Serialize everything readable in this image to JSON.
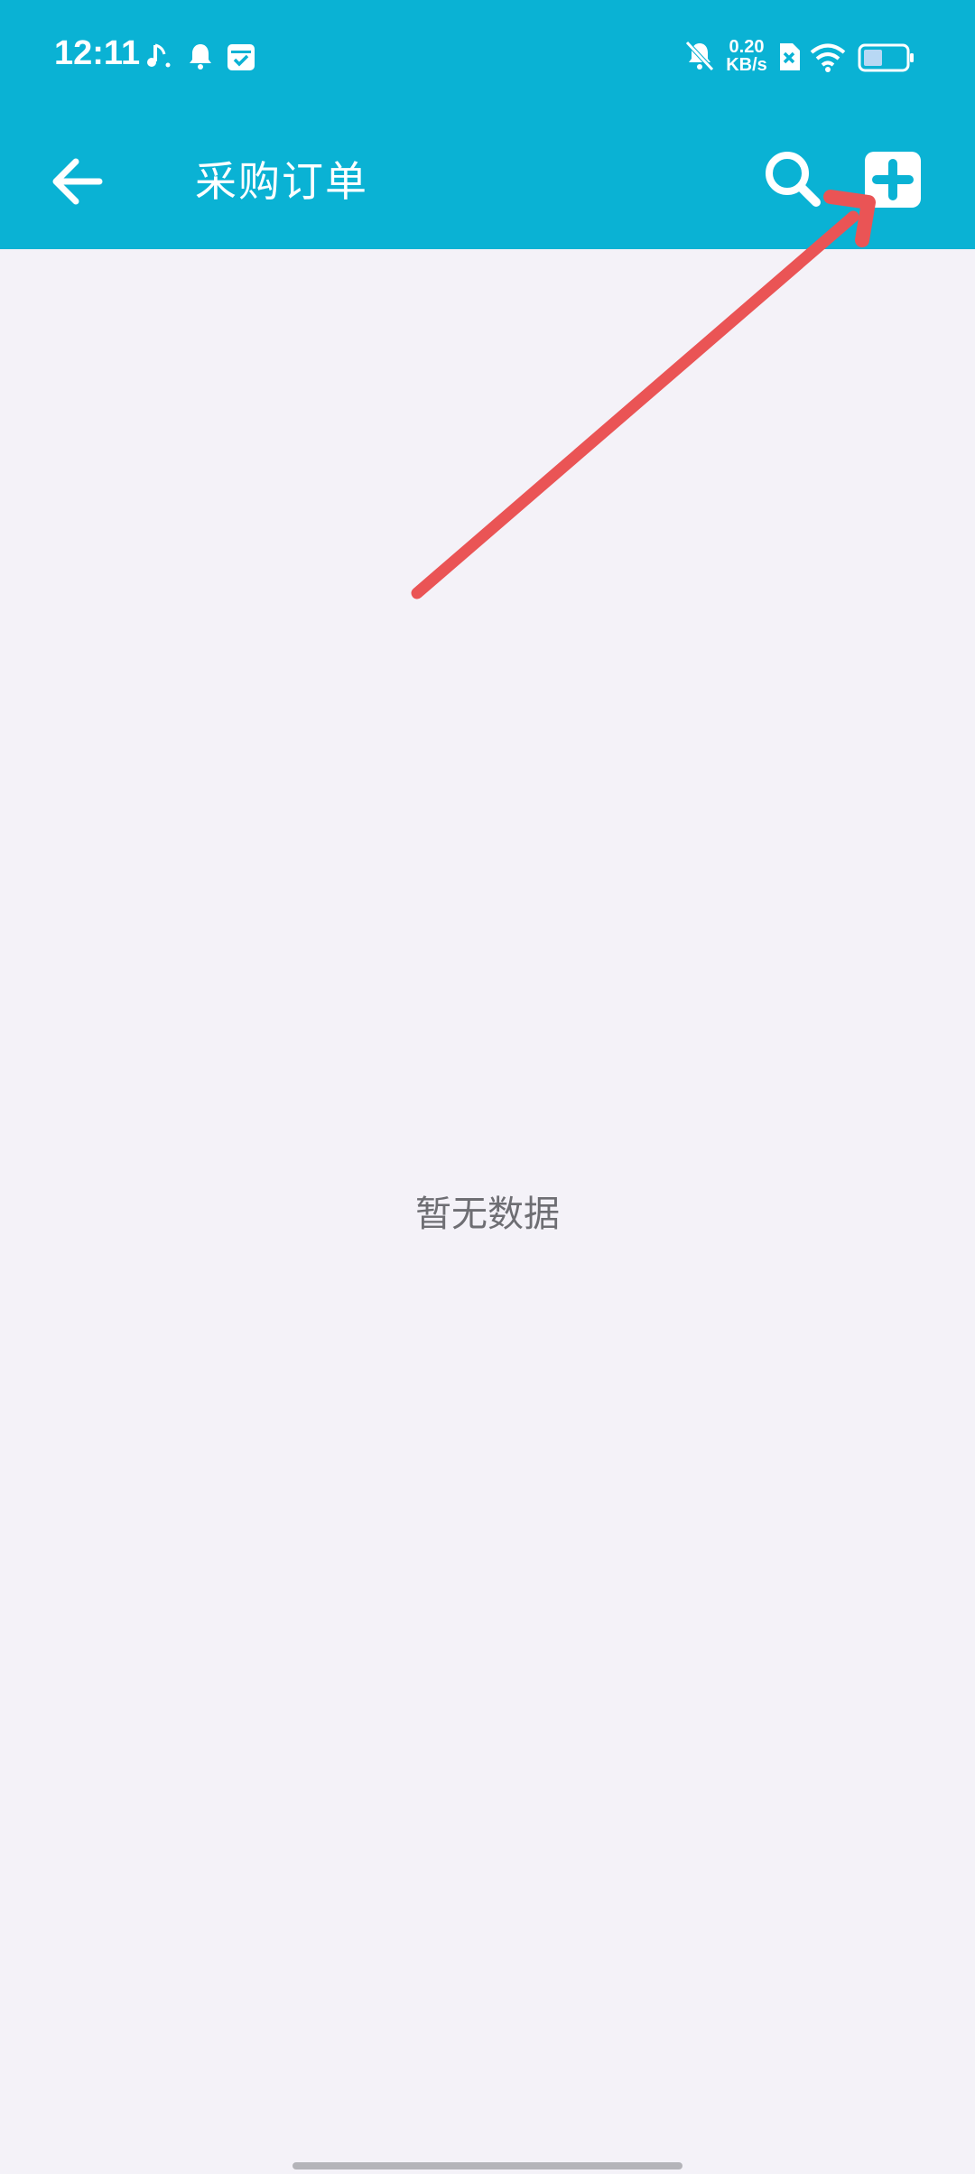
{
  "status_bar": {
    "time": "12:11",
    "net_speed_value": "0.20",
    "net_speed_unit": "KB/s",
    "icons": [
      "music-note-icon",
      "bell-icon",
      "calendar-check-icon",
      "bell-off-icon",
      "sim-off-icon",
      "wifi-icon",
      "battery-icon"
    ]
  },
  "app_bar": {
    "title": "采购订单",
    "back_icon": "back-arrow-icon",
    "search_icon": "search-icon",
    "add_icon": "add-icon"
  },
  "content": {
    "empty_text": "暂无数据"
  },
  "colors": {
    "header": "#0ab2d4",
    "background": "#f4f2f8",
    "annotation_arrow": "#ea5455",
    "empty_text": "#6e6e73"
  }
}
